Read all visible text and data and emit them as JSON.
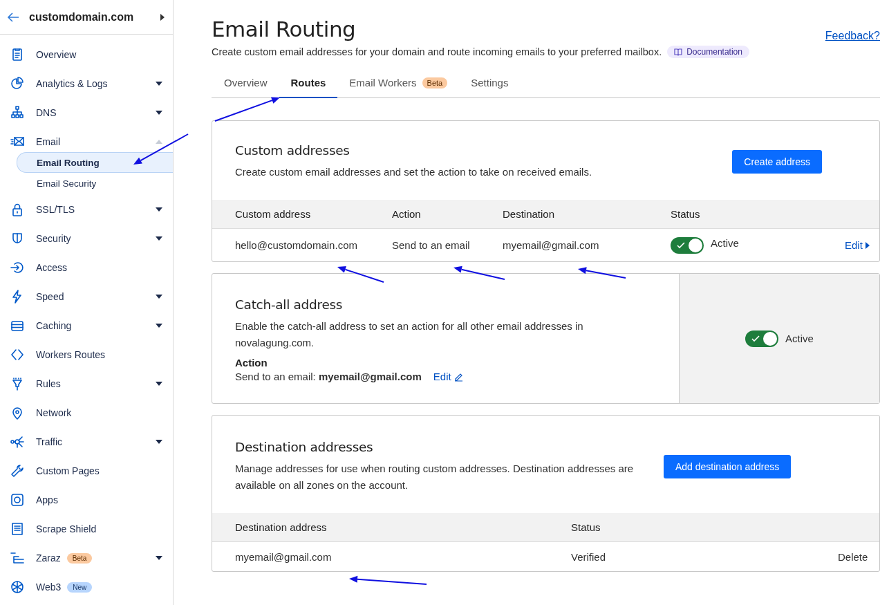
{
  "sidebar": {
    "domain": "customdomain.com",
    "items": [
      {
        "label": "Overview"
      },
      {
        "label": "Analytics & Logs",
        "expanded": false
      },
      {
        "label": "DNS",
        "expanded": false
      },
      {
        "label": "Email",
        "expanded": true,
        "children": [
          {
            "label": "Email Routing",
            "selected": true
          },
          {
            "label": "Email Security",
            "selected": false
          }
        ]
      },
      {
        "label": "SSL/TLS",
        "expanded": false
      },
      {
        "label": "Security",
        "expanded": false
      },
      {
        "label": "Access"
      },
      {
        "label": "Speed",
        "expanded": false
      },
      {
        "label": "Caching",
        "expanded": false
      },
      {
        "label": "Workers Routes"
      },
      {
        "label": "Rules",
        "expanded": false
      },
      {
        "label": "Network"
      },
      {
        "label": "Traffic",
        "expanded": false
      },
      {
        "label": "Custom Pages"
      },
      {
        "label": "Apps"
      },
      {
        "label": "Scrape Shield"
      },
      {
        "label": "Zaraz",
        "badge": "Beta",
        "kind": "beta",
        "expanded": false
      },
      {
        "label": "Web3",
        "badge": "New",
        "kind": "new"
      }
    ]
  },
  "header": {
    "title": "Email Routing",
    "description": "Create custom email addresses for your domain and route incoming emails to your preferred mailbox.",
    "documentation_link": "Documentation",
    "feedback_link": "Feedback?"
  },
  "tabs": [
    {
      "label": "Overview",
      "selected": false
    },
    {
      "label": "Routes",
      "selected": true
    },
    {
      "label": "Email Workers",
      "selected": false,
      "badge": "Beta"
    },
    {
      "label": "Settings",
      "selected": false
    }
  ],
  "custom_addresses": {
    "title": "Custom addresses",
    "description": "Create custom email addresses and set the action to take on received emails.",
    "button": "Create address",
    "columns": [
      "Custom address",
      "Action",
      "Destination",
      "Status"
    ],
    "rows": [
      {
        "address": "hello@customdomain.com",
        "action": "Send to an email",
        "destination": "myemail@gmail.com",
        "on": true,
        "status": "Active",
        "edit": "Edit"
      }
    ]
  },
  "catch_all": {
    "title": "Catch-all address",
    "description": "Enable the catch-all address to set an action for all other email addresses in novalagung.com.",
    "action_label": "Action",
    "action_text": "Send to an email: **myemail@gmail.com**",
    "edit": "Edit",
    "on": true,
    "status": "Active"
  },
  "destination_addresses": {
    "title": "Destination addresses",
    "description": "Manage addresses for use when routing custom addresses. Destination addresses are available on all zones on the account.",
    "button": "Add destination address",
    "columns": [
      "Destination address",
      "Status"
    ],
    "rows": [
      {
        "address": "myemail@gmail.com",
        "status": "Verified",
        "delete": "Delete"
      }
    ]
  }
}
